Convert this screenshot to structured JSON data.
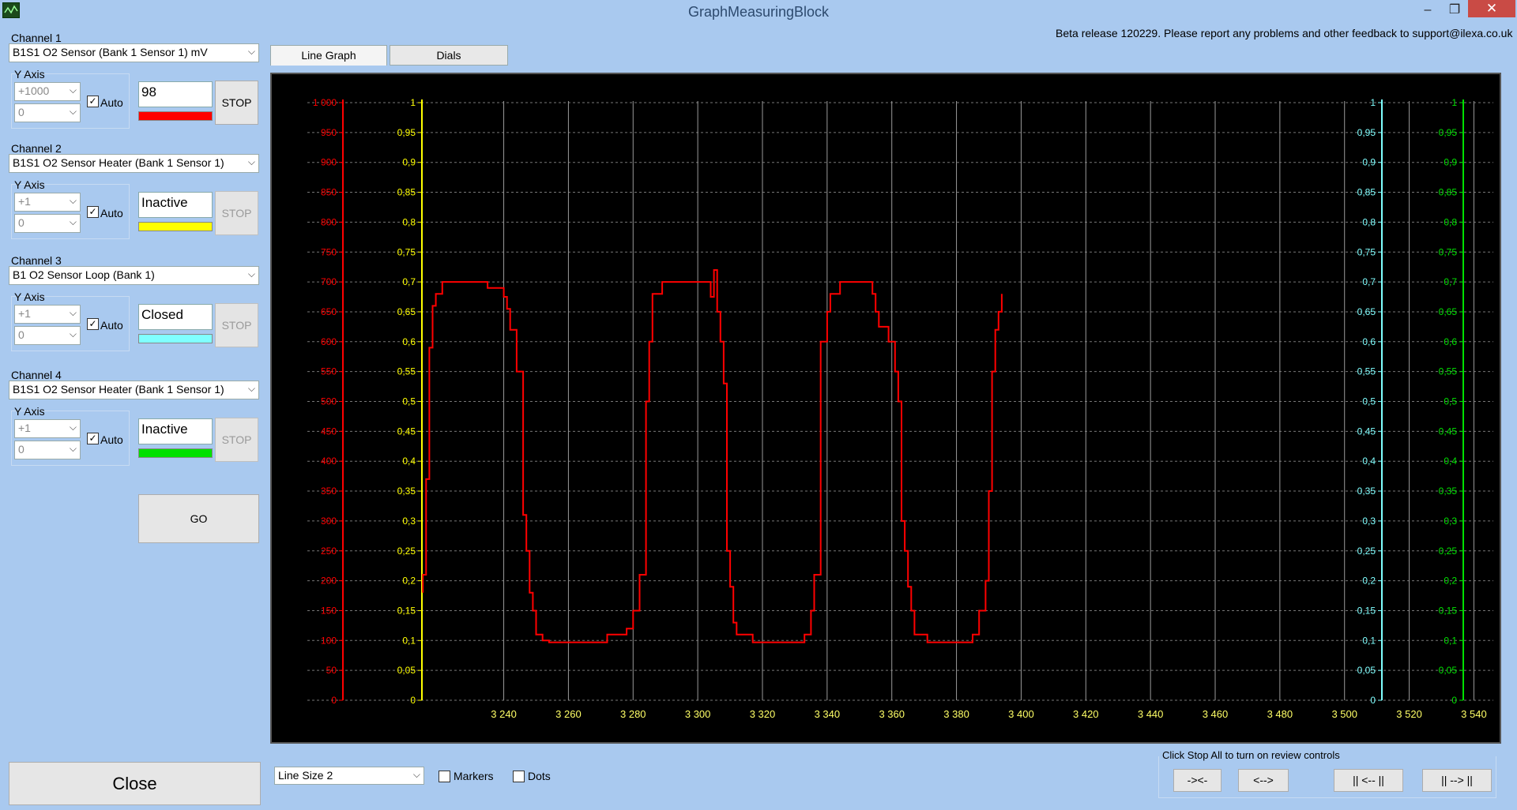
{
  "window": {
    "title": "GraphMeasuringBlock",
    "minimize": "–",
    "maximize": "❐",
    "close": "✕"
  },
  "beta_notice": "Beta release 120229. Please report any problems and other feedback to support@ilexa.co.uk",
  "channels": [
    {
      "heading": "Channel 1",
      "sensor": "B1S1 O2 Sensor (Bank 1 Sensor 1)  mV",
      "yaxis_label": "Y Axis",
      "y_max": "+1000",
      "y_min": "0",
      "auto_label": "Auto",
      "auto_checked": true,
      "value": "98",
      "color": "#ff0000",
      "stop_label": "STOP",
      "stop_enabled": true
    },
    {
      "heading": "Channel 2",
      "sensor": "B1S1 O2 Sensor Heater (Bank 1 Sensor 1)",
      "yaxis_label": "Y Axis",
      "y_max": "+1",
      "y_min": "0",
      "auto_label": "Auto",
      "auto_checked": true,
      "value": "Inactive",
      "color": "#ffff00",
      "stop_label": "STOP",
      "stop_enabled": false
    },
    {
      "heading": "Channel 3",
      "sensor": "B1 O2 Sensor Loop (Bank 1)",
      "yaxis_label": "Y Axis",
      "y_max": "+1",
      "y_min": "0",
      "auto_label": "Auto",
      "auto_checked": true,
      "value": "Closed",
      "color": "#80ffff",
      "stop_label": "STOP",
      "stop_enabled": false
    },
    {
      "heading": "Channel 4",
      "sensor": "B1S1 O2 Sensor Heater (Bank 1 Sensor 1)",
      "yaxis_label": "Y Axis",
      "y_max": "+1",
      "y_min": "0",
      "auto_label": "Auto",
      "auto_checked": true,
      "value": "Inactive",
      "color": "#00e000",
      "stop_label": "STOP",
      "stop_enabled": false
    }
  ],
  "go_label": "GO",
  "close_label": "Close",
  "tabs": [
    {
      "label": "Line Graph",
      "active": true
    },
    {
      "label": "Dials",
      "active": false
    }
  ],
  "bottom": {
    "line_size": "Line Size 2",
    "markers_label": "Markers",
    "dots_label": "Dots",
    "review_hint": "Click Stop All to turn on review controls",
    "nav_buttons": [
      "-><-",
      "<-->",
      "|| <-- ||",
      "|| --> ||"
    ]
  },
  "chart_data": {
    "type": "line",
    "x_ticks": [
      "3 240",
      "3 260",
      "3 280",
      "3 300",
      "3 320",
      "3 340",
      "3 360",
      "3 380",
      "3 400",
      "3 420",
      "3 440",
      "3 460",
      "3 480",
      "3 500",
      "3 520",
      "3 540"
    ],
    "xlim": [
      3234,
      3546
    ],
    "y_axes": [
      {
        "color": "#ff0000",
        "range": [
          0,
          1000
        ],
        "ticks": [
          "0",
          "50",
          "100",
          "150",
          "200",
          "250",
          "300",
          "350",
          "400",
          "450",
          "500",
          "550",
          "600",
          "650",
          "700",
          "750",
          "800",
          "850",
          "900",
          "950",
          "1 000"
        ]
      },
      {
        "color": "#ffff00",
        "range": [
          0,
          1
        ],
        "ticks": [
          "0",
          "0,05",
          "0,1",
          "0,15",
          "0,2",
          "0,25",
          "0,3",
          "0,35",
          "0,4",
          "0,45",
          "0,5",
          "0,55",
          "0,6",
          "0,65",
          "0,7",
          "0,75",
          "0,8",
          "0,85",
          "0,9",
          "0,95",
          "1"
        ]
      },
      {
        "color": "#80ffff",
        "range": [
          0,
          1
        ],
        "ticks": [
          "0",
          "0,05",
          "0,1",
          "0,15",
          "0,2",
          "0,25",
          "0,3",
          "0,35",
          "0,4",
          "0,45",
          "0,5",
          "0,55",
          "0,6",
          "0,65",
          "0,7",
          "0,75",
          "0,8",
          "0,85",
          "0,9",
          "0,95",
          "1"
        ]
      },
      {
        "color": "#00e000",
        "range": [
          0,
          1
        ],
        "ticks": [
          "0",
          "0,05",
          "0,1",
          "0,15",
          "0,2",
          "0,25",
          "0,3",
          "0,35",
          "0,4",
          "0,45",
          "0,5",
          "0,55",
          "0,6",
          "0,65",
          "0,7",
          "0,75",
          "0,8",
          "0,85",
          "0,9",
          "0,95",
          "1"
        ]
      }
    ],
    "grid": true,
    "series": [
      {
        "color": "#ff0000",
        "points": [
          [
            3215,
            180
          ],
          [
            3215,
            210
          ],
          [
            3216,
            210
          ],
          [
            3216,
            370
          ],
          [
            3217,
            370
          ],
          [
            3217,
            590
          ],
          [
            3218,
            590
          ],
          [
            3218,
            660
          ],
          [
            3219,
            660
          ],
          [
            3219,
            680
          ],
          [
            3221,
            680
          ],
          [
            3221,
            700
          ],
          [
            3235,
            700
          ],
          [
            3235,
            690
          ],
          [
            3240,
            690
          ],
          [
            3240,
            675
          ],
          [
            3241,
            675
          ],
          [
            3241,
            655
          ],
          [
            3242,
            655
          ],
          [
            3242,
            620
          ],
          [
            3244,
            620
          ],
          [
            3244,
            550
          ],
          [
            3246,
            550
          ],
          [
            3246,
            310
          ],
          [
            3247,
            310
          ],
          [
            3247,
            250
          ],
          [
            3248,
            250
          ],
          [
            3248,
            180
          ],
          [
            3249,
            180
          ],
          [
            3249,
            150
          ],
          [
            3250,
            150
          ],
          [
            3250,
            110
          ],
          [
            3252,
            110
          ],
          [
            3252,
            100
          ],
          [
            3254,
            100
          ],
          [
            3254,
            97
          ],
          [
            3272,
            97
          ],
          [
            3272,
            110
          ],
          [
            3278,
            110
          ],
          [
            3278,
            120
          ],
          [
            3280,
            120
          ],
          [
            3280,
            150
          ],
          [
            3282,
            150
          ],
          [
            3282,
            210
          ],
          [
            3284,
            210
          ],
          [
            3284,
            500
          ],
          [
            3285,
            500
          ],
          [
            3285,
            600
          ],
          [
            3286,
            600
          ],
          [
            3286,
            680
          ],
          [
            3289,
            680
          ],
          [
            3289,
            700
          ],
          [
            3304,
            700
          ],
          [
            3304,
            675
          ],
          [
            3305,
            675
          ],
          [
            3305,
            720
          ],
          [
            3306,
            720
          ],
          [
            3306,
            650
          ],
          [
            3307,
            650
          ],
          [
            3307,
            600
          ],
          [
            3308,
            600
          ],
          [
            3308,
            530
          ],
          [
            3309,
            530
          ],
          [
            3309,
            250
          ],
          [
            3310,
            250
          ],
          [
            3310,
            190
          ],
          [
            3311,
            190
          ],
          [
            3311,
            130
          ],
          [
            3312,
            130
          ],
          [
            3312,
            110
          ],
          [
            3317,
            110
          ],
          [
            3317,
            97
          ],
          [
            3333,
            97
          ],
          [
            3333,
            110
          ],
          [
            3335,
            110
          ],
          [
            3335,
            150
          ],
          [
            3336,
            150
          ],
          [
            3336,
            210
          ],
          [
            3338,
            210
          ],
          [
            3338,
            600
          ],
          [
            3340,
            600
          ],
          [
            3340,
            650
          ],
          [
            3341,
            650
          ],
          [
            3341,
            680
          ],
          [
            3344,
            680
          ],
          [
            3344,
            700
          ],
          [
            3354,
            700
          ],
          [
            3354,
            680
          ],
          [
            3355,
            680
          ],
          [
            3355,
            650
          ],
          [
            3356,
            650
          ],
          [
            3356,
            625
          ],
          [
            3359,
            625
          ],
          [
            3359,
            600
          ],
          [
            3361,
            600
          ],
          [
            3361,
            550
          ],
          [
            3362,
            550
          ],
          [
            3362,
            500
          ],
          [
            3363,
            500
          ],
          [
            3363,
            300
          ],
          [
            3364,
            300
          ],
          [
            3364,
            250
          ],
          [
            3365,
            250
          ],
          [
            3365,
            190
          ],
          [
            3366,
            190
          ],
          [
            3366,
            150
          ],
          [
            3367,
            150
          ],
          [
            3367,
            110
          ],
          [
            3371,
            110
          ],
          [
            3371,
            97
          ],
          [
            3385,
            97
          ],
          [
            3385,
            110
          ],
          [
            3387,
            110
          ],
          [
            3387,
            150
          ],
          [
            3389,
            150
          ],
          [
            3389,
            200
          ],
          [
            3390,
            200
          ],
          [
            3390,
            350
          ],
          [
            3391,
            350
          ],
          [
            3391,
            550
          ],
          [
            3392,
            550
          ],
          [
            3392,
            620
          ],
          [
            3393,
            620
          ],
          [
            3393,
            650
          ],
          [
            3394,
            650
          ],
          [
            3394,
            680
          ]
        ]
      }
    ]
  }
}
